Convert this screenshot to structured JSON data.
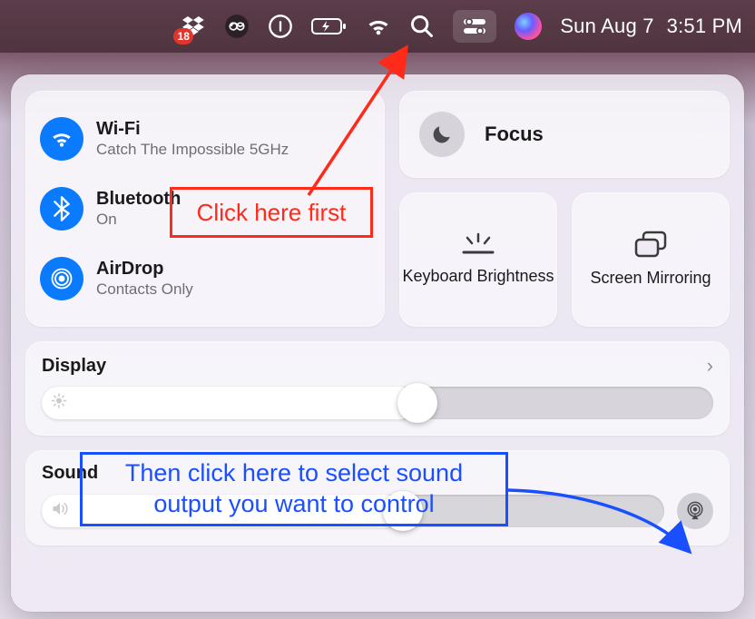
{
  "menubar": {
    "dropbox_badge": "18",
    "date": "Sun Aug 7",
    "time": "3:51 PM"
  },
  "control_center": {
    "wifi": {
      "title": "Wi-Fi",
      "subtitle": "Catch The Impossible 5GHz"
    },
    "bluetooth": {
      "title": "Bluetooth",
      "subtitle": "On"
    },
    "airdrop": {
      "title": "AirDrop",
      "subtitle": "Contacts Only"
    },
    "focus": {
      "title": "Focus"
    },
    "keyboard_brightness": {
      "label": "Keyboard Brightness"
    },
    "screen_mirroring": {
      "label": "Screen Mirroring"
    },
    "display": {
      "title": "Display",
      "value_percent": 56
    },
    "sound": {
      "title": "Sound",
      "value_percent": 58
    }
  },
  "annotations": {
    "step1": "Click here first",
    "step2": "Then click here to select sound output you want to control"
  }
}
